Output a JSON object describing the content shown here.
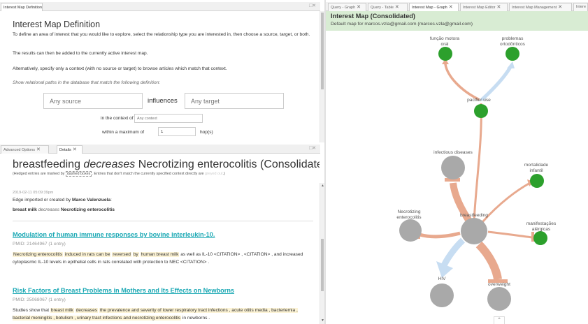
{
  "left_top": {
    "tab_label": "Interest Map Definition",
    "title": "Interest Map Definition",
    "intro": "To define an area of interest that you would like to explore, select the relationship type you are interested in, then choose a source, target, or both.",
    "results_text": "The results can then be added to the currently active interest map.",
    "alt_text": "Alternatively, specify only a context (with no source or target) to browse articles which match that context.",
    "show_text": "Show relational paths in the database that match the following definition:",
    "source_placeholder": "Any source",
    "relation": "influences",
    "target_placeholder": "Any target",
    "context_label": "in the context of",
    "context_placeholder": "Any context",
    "within_label": "within a maximum of",
    "hops_value": "1",
    "hops_unit": "hop(s)"
  },
  "left_bottom": {
    "tabs": [
      "Advanced Options",
      "Details"
    ],
    "title_source": "breastfeeding",
    "title_relation": "decreases",
    "title_target": "Necrotizing enterocolitis (Consolidated)",
    "note_prefix": "(Hedged entries are marked by",
    "note_dashed": "dashed boxes",
    "note_mid": ". Entries that don't match the currently specified context directly are",
    "note_greyed": "greyed out",
    "note_suffix": ".)",
    "timestamp": "2019-02-11 05:09:39pm",
    "edge_text": "Edge imported or created by",
    "edge_author": "Marco Valenzuela",
    "edge_colon": ":",
    "rel_source": "breast milk",
    "rel_relation": "decreases",
    "rel_target": "Necrotizing enterocolitis",
    "articles": [
      {
        "title": "Modulation of human immune responses by bovine interleukin-10.",
        "pmid": "PMID: 21464967 (1 entry)",
        "seg1": "Necrotizing enterocolitis",
        "seg2": "induced in rats can be",
        "seg3": "reversed",
        "seg4": "by",
        "seg5": "human breast milk",
        "seg6": "as well as IL-10 <CITATION> , <CITATION> , and increased cytoplasmic IL-10 levels in epithelial cells in rats correlated with protection to NEC <CITATION> ."
      },
      {
        "title": "Risk Factors of Breast Problems in Mothers and Its Effects on Newborns",
        "pmid": "PMID: 25068067 (1 entry)",
        "seg1": "Studies show that",
        "seg2": "breast milk",
        "seg3": "decreases",
        "seg4": "the prevalence and severity of lower respiratory tract infections , acute otitis media , bacteriemia , bacterial meningitis , botulism , urinary tract infections and necrotizing enterocolitis",
        "seg5": "in newborns ."
      }
    ]
  },
  "right": {
    "tabs": [
      "Query - Graph",
      "Query - Table",
      "Interest Map - Graph",
      "Interest Map Editor",
      "Interest Map Management",
      "Intere"
    ],
    "map_title": "Interest Map (Consolidated)",
    "map_subtitle": "Default map for marcos.vzla@gmail.com (marcos.vzla@gmail.com)",
    "nodes": {
      "funcao": [
        "função motora",
        "oral"
      ],
      "problemas": [
        "problemas",
        "ortodônticos"
      ],
      "pacifier": "pacifier use",
      "infectious": "infectious diseases",
      "mortalidade": [
        "mortalidade",
        "infantil"
      ],
      "necrotizing": [
        "Necrotizing",
        "enterocolitis"
      ],
      "breastfeeding": "breastfeeding",
      "manifestacoes": [
        "manifestações",
        "alérgicas"
      ],
      "hiv": "HIV",
      "overweight": "overweight"
    },
    "colors": {
      "green": "#2ca02c",
      "grey": "#a9a9a9",
      "orange": "#e8a98e",
      "blue": "#c7ddf2",
      "header_bg": "#d8ecd3"
    }
  }
}
